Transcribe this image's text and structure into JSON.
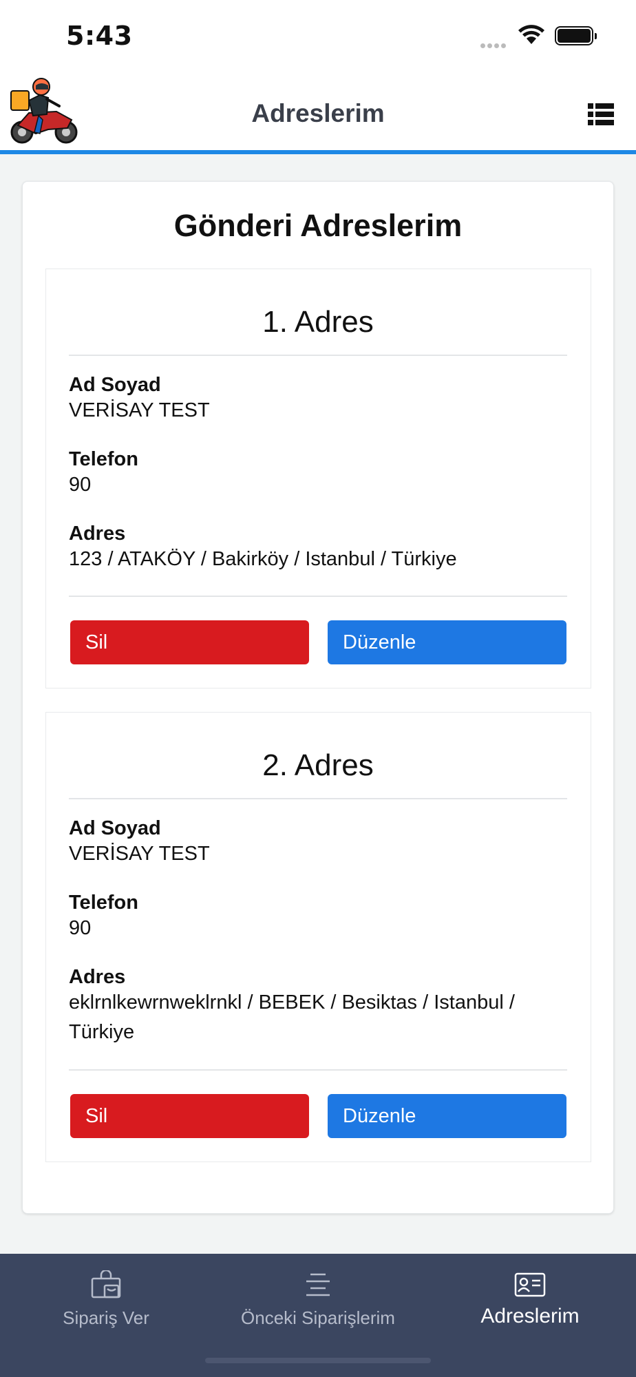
{
  "status_bar": {
    "time": "5:43"
  },
  "header": {
    "title": "Adreslerim"
  },
  "main": {
    "title": "Gönderi Adreslerim",
    "addresses": [
      {
        "heading": "1. Adres",
        "name_label": "Ad Soyad",
        "name": "VERİSAY TEST",
        "phone_label": "Telefon",
        "phone": "90",
        "address_label": "Adres",
        "address": "123 / ATAKÖY / Bakirköy / Istanbul / Türkiye",
        "delete_label": "Sil",
        "edit_label": "Düzenle"
      },
      {
        "heading": "2. Adres",
        "name_label": "Ad Soyad",
        "name": "VERİSAY TEST",
        "phone_label": "Telefon",
        "phone": "90",
        "address_label": "Adres",
        "address": "eklrnlkewrnweklrnkl / BEBEK / Besiktas / Istanbul / Türkiye",
        "delete_label": "Sil",
        "edit_label": "Düzenle"
      }
    ]
  },
  "tabbar": {
    "tabs": [
      {
        "label": "Sipariş Ver",
        "icon": "shopping-bag-icon",
        "active": false
      },
      {
        "label": "Önceki Siparişlerim",
        "icon": "list-lines-icon",
        "active": false
      },
      {
        "label": "Adreslerim",
        "icon": "contact-card-icon",
        "active": true
      }
    ]
  },
  "colors": {
    "accent": "#1e88e5",
    "delete": "#d81b1f",
    "edit": "#1e78e3",
    "tabbar": "#3b4660"
  }
}
